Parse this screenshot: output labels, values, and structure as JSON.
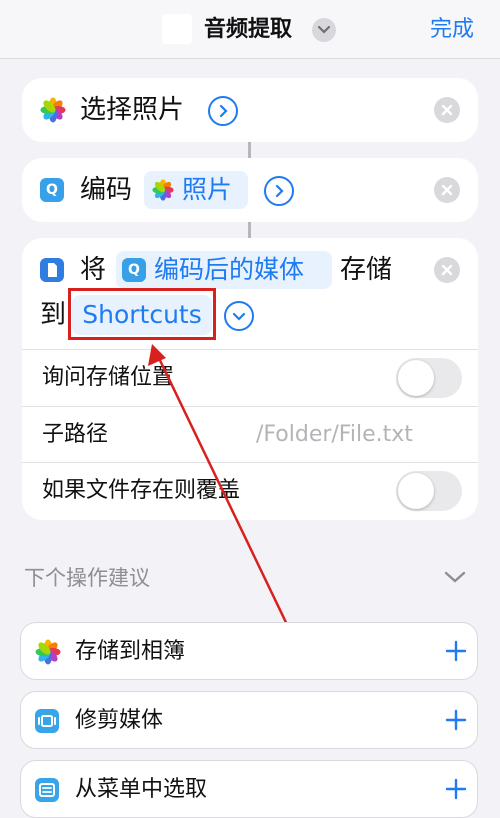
{
  "header": {
    "title": "音频提取",
    "done_label": "完成"
  },
  "actions": [
    {
      "icon": "photos-icon",
      "label": "选择照片"
    },
    {
      "icon": "encode-icon",
      "label": "编码",
      "param": "照片"
    },
    {
      "icon": "document-icon",
      "prefix": "将",
      "param": "编码后的媒体",
      "middle": "存储",
      "suffix": "到",
      "destination": "Shortcuts",
      "options": [
        {
          "label": "询问存储位置",
          "toggle_on": false
        },
        {
          "label": "子路径",
          "placeholder": "/Folder/File.txt"
        },
        {
          "label": "如果文件存在则覆盖",
          "toggle_on": false
        }
      ]
    }
  ],
  "suggestions": {
    "title": "下个操作建议",
    "items": [
      {
        "icon": "photos-icon",
        "label": "存储到相簿"
      },
      {
        "icon": "trim-media-icon",
        "label": "修剪媒体"
      },
      {
        "icon": "menu-icon",
        "label": "从菜单中选取"
      }
    ]
  },
  "colors": {
    "accent": "#1e7bf0",
    "annotation": "#d8201f",
    "background": "#f2f2f7"
  }
}
